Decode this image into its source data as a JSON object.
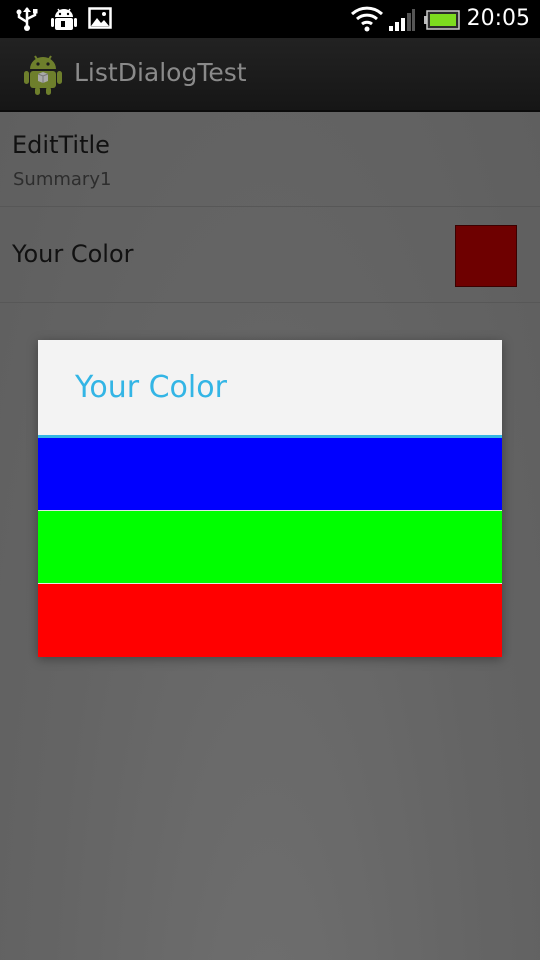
{
  "status_bar": {
    "time": "20:05",
    "icons": [
      "usb-icon",
      "android-debug-icon",
      "gallery-icon",
      "wifi-icon",
      "signal-icon",
      "battery-icon"
    ]
  },
  "app": {
    "title": "ListDialogTest",
    "icon": "android-robot-icon"
  },
  "preferences": [
    {
      "title": "EditTitle",
      "summary": "Summary1"
    },
    {
      "title": "Your Color",
      "swatch_color": "#6e0000"
    }
  ],
  "dialog": {
    "title": "Your Color",
    "accent_color": "#33b5e5",
    "options": [
      {
        "name": "blue",
        "color": "#0000ff"
      },
      {
        "name": "green",
        "color": "#00ff00"
      },
      {
        "name": "red",
        "color": "#ff0000"
      }
    ]
  }
}
